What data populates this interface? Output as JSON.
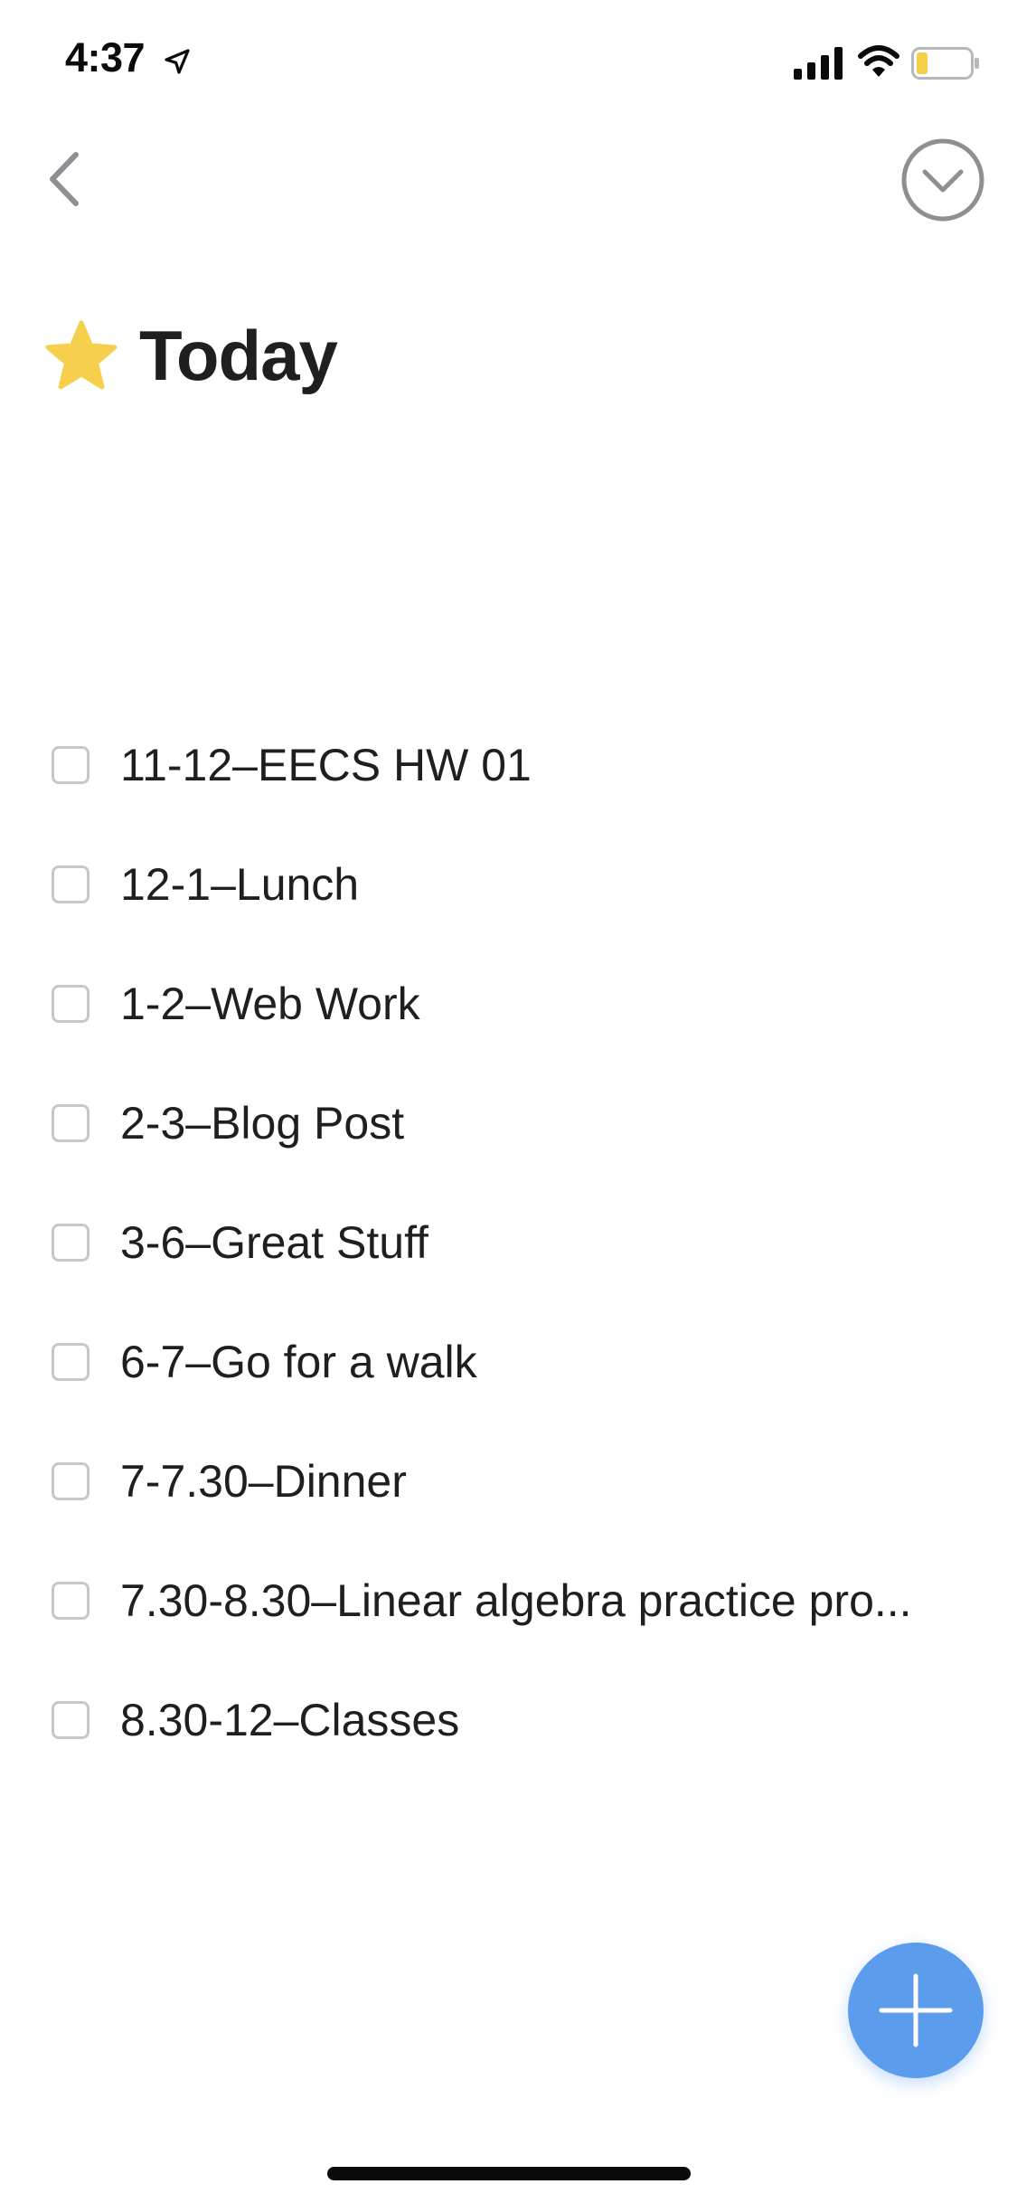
{
  "status_bar": {
    "time": "4:37",
    "icons": [
      "location-arrow-icon",
      "cellular-signal-icon",
      "wifi-icon",
      "battery-low-icon"
    ],
    "battery_color": "#f4cf4a"
  },
  "nav": {
    "back_icon": "chevron-left-icon",
    "more_icon": "circle-chevron-down-icon"
  },
  "header": {
    "icon": "star-icon",
    "star_color": "#f6d04d",
    "title": "Today"
  },
  "tasks": [
    {
      "title": "11-12–EECS HW 01",
      "done": false
    },
    {
      "title": "12-1–Lunch",
      "done": false
    },
    {
      "title": "1-2–Web Work",
      "done": false
    },
    {
      "title": "2-3–Blog Post",
      "done": false
    },
    {
      "title": "3-6–Great Stuff",
      "done": false
    },
    {
      "title": "6-7–Go for a walk",
      "done": false
    },
    {
      "title": "7-7.30–Dinner",
      "done": false
    },
    {
      "title": "7.30-8.30–Linear algebra practice pro...",
      "done": false
    },
    {
      "title": "8.30-12–Classes",
      "done": false
    }
  ],
  "fab": {
    "icon": "plus-icon",
    "color": "#5b9ced"
  }
}
